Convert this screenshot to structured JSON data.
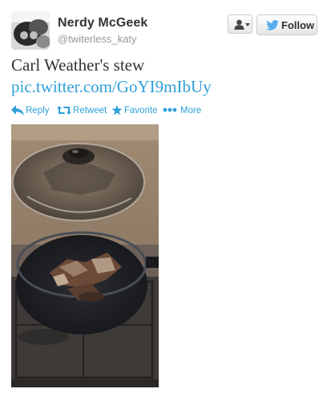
{
  "user": {
    "display_name": "Nerdy McGeek",
    "screen_name": "@twiterless_katy"
  },
  "buttons": {
    "follow_label": "Follow",
    "user_menu_icon": "person-icon"
  },
  "tweet": {
    "text": "Carl Weather's stew",
    "link": "pic.twitter.com/GoYI9mIbUy"
  },
  "actions": [
    {
      "label": "Reply",
      "icon": "reply-icon"
    },
    {
      "label": "Retweet",
      "icon": "retweet-icon"
    },
    {
      "label": "Favorite",
      "icon": "star-icon"
    },
    {
      "label": "More",
      "icon": "more-dots-icon"
    }
  ],
  "colors": {
    "link_blue": "#2fa0d9",
    "twitter_bird": "#55acee",
    "text_dark": "#333333",
    "text_muted": "#999999"
  }
}
